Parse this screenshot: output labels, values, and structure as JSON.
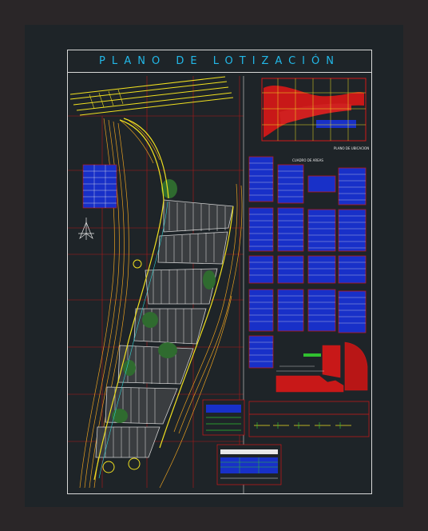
{
  "title": "PLANO DE LOTIZACIÓN",
  "labels": {
    "location_plan": "PLANO DE UBICACION",
    "areas_table": "CUADRO DE AREAS"
  },
  "colors": {
    "background": "#2a2628",
    "viewport": "#1e2428",
    "frame": "#d8d8d8",
    "title": "#22b8e8",
    "contour": "#e8a020",
    "lots": "#d0d0d0",
    "road": "#f0e020",
    "green": "#2f6b2f",
    "red_grid": "#d01818",
    "table_fill": "#1830c8"
  }
}
